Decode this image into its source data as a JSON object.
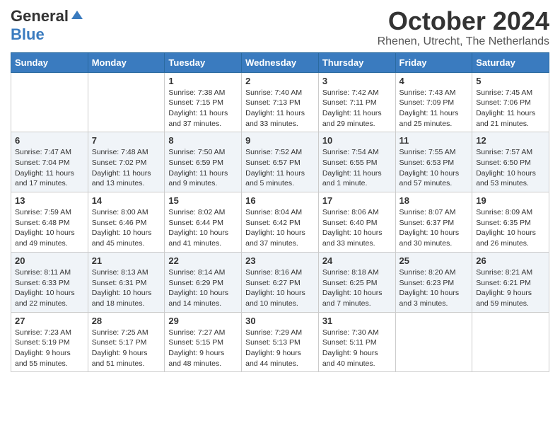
{
  "logo": {
    "general": "General",
    "blue": "Blue"
  },
  "title": "October 2024",
  "location": "Rhenen, Utrecht, The Netherlands",
  "weekdays": [
    "Sunday",
    "Monday",
    "Tuesday",
    "Wednesday",
    "Thursday",
    "Friday",
    "Saturday"
  ],
  "weeks": [
    [
      {
        "day": "",
        "sunrise": "",
        "sunset": "",
        "daylight": ""
      },
      {
        "day": "",
        "sunrise": "",
        "sunset": "",
        "daylight": ""
      },
      {
        "day": "1",
        "sunrise": "Sunrise: 7:38 AM",
        "sunset": "Sunset: 7:15 PM",
        "daylight": "Daylight: 11 hours and 37 minutes."
      },
      {
        "day": "2",
        "sunrise": "Sunrise: 7:40 AM",
        "sunset": "Sunset: 7:13 PM",
        "daylight": "Daylight: 11 hours and 33 minutes."
      },
      {
        "day": "3",
        "sunrise": "Sunrise: 7:42 AM",
        "sunset": "Sunset: 7:11 PM",
        "daylight": "Daylight: 11 hours and 29 minutes."
      },
      {
        "day": "4",
        "sunrise": "Sunrise: 7:43 AM",
        "sunset": "Sunset: 7:09 PM",
        "daylight": "Daylight: 11 hours and 25 minutes."
      },
      {
        "day": "5",
        "sunrise": "Sunrise: 7:45 AM",
        "sunset": "Sunset: 7:06 PM",
        "daylight": "Daylight: 11 hours and 21 minutes."
      }
    ],
    [
      {
        "day": "6",
        "sunrise": "Sunrise: 7:47 AM",
        "sunset": "Sunset: 7:04 PM",
        "daylight": "Daylight: 11 hours and 17 minutes."
      },
      {
        "day": "7",
        "sunrise": "Sunrise: 7:48 AM",
        "sunset": "Sunset: 7:02 PM",
        "daylight": "Daylight: 11 hours and 13 minutes."
      },
      {
        "day": "8",
        "sunrise": "Sunrise: 7:50 AM",
        "sunset": "Sunset: 6:59 PM",
        "daylight": "Daylight: 11 hours and 9 minutes."
      },
      {
        "day": "9",
        "sunrise": "Sunrise: 7:52 AM",
        "sunset": "Sunset: 6:57 PM",
        "daylight": "Daylight: 11 hours and 5 minutes."
      },
      {
        "day": "10",
        "sunrise": "Sunrise: 7:54 AM",
        "sunset": "Sunset: 6:55 PM",
        "daylight": "Daylight: 11 hours and 1 minute."
      },
      {
        "day": "11",
        "sunrise": "Sunrise: 7:55 AM",
        "sunset": "Sunset: 6:53 PM",
        "daylight": "Daylight: 10 hours and 57 minutes."
      },
      {
        "day": "12",
        "sunrise": "Sunrise: 7:57 AM",
        "sunset": "Sunset: 6:50 PM",
        "daylight": "Daylight: 10 hours and 53 minutes."
      }
    ],
    [
      {
        "day": "13",
        "sunrise": "Sunrise: 7:59 AM",
        "sunset": "Sunset: 6:48 PM",
        "daylight": "Daylight: 10 hours and 49 minutes."
      },
      {
        "day": "14",
        "sunrise": "Sunrise: 8:00 AM",
        "sunset": "Sunset: 6:46 PM",
        "daylight": "Daylight: 10 hours and 45 minutes."
      },
      {
        "day": "15",
        "sunrise": "Sunrise: 8:02 AM",
        "sunset": "Sunset: 6:44 PM",
        "daylight": "Daylight: 10 hours and 41 minutes."
      },
      {
        "day": "16",
        "sunrise": "Sunrise: 8:04 AM",
        "sunset": "Sunset: 6:42 PM",
        "daylight": "Daylight: 10 hours and 37 minutes."
      },
      {
        "day": "17",
        "sunrise": "Sunrise: 8:06 AM",
        "sunset": "Sunset: 6:40 PM",
        "daylight": "Daylight: 10 hours and 33 minutes."
      },
      {
        "day": "18",
        "sunrise": "Sunrise: 8:07 AM",
        "sunset": "Sunset: 6:37 PM",
        "daylight": "Daylight: 10 hours and 30 minutes."
      },
      {
        "day": "19",
        "sunrise": "Sunrise: 8:09 AM",
        "sunset": "Sunset: 6:35 PM",
        "daylight": "Daylight: 10 hours and 26 minutes."
      }
    ],
    [
      {
        "day": "20",
        "sunrise": "Sunrise: 8:11 AM",
        "sunset": "Sunset: 6:33 PM",
        "daylight": "Daylight: 10 hours and 22 minutes."
      },
      {
        "day": "21",
        "sunrise": "Sunrise: 8:13 AM",
        "sunset": "Sunset: 6:31 PM",
        "daylight": "Daylight: 10 hours and 18 minutes."
      },
      {
        "day": "22",
        "sunrise": "Sunrise: 8:14 AM",
        "sunset": "Sunset: 6:29 PM",
        "daylight": "Daylight: 10 hours and 14 minutes."
      },
      {
        "day": "23",
        "sunrise": "Sunrise: 8:16 AM",
        "sunset": "Sunset: 6:27 PM",
        "daylight": "Daylight: 10 hours and 10 minutes."
      },
      {
        "day": "24",
        "sunrise": "Sunrise: 8:18 AM",
        "sunset": "Sunset: 6:25 PM",
        "daylight": "Daylight: 10 hours and 7 minutes."
      },
      {
        "day": "25",
        "sunrise": "Sunrise: 8:20 AM",
        "sunset": "Sunset: 6:23 PM",
        "daylight": "Daylight: 10 hours and 3 minutes."
      },
      {
        "day": "26",
        "sunrise": "Sunrise: 8:21 AM",
        "sunset": "Sunset: 6:21 PM",
        "daylight": "Daylight: 9 hours and 59 minutes."
      }
    ],
    [
      {
        "day": "27",
        "sunrise": "Sunrise: 7:23 AM",
        "sunset": "Sunset: 5:19 PM",
        "daylight": "Daylight: 9 hours and 55 minutes."
      },
      {
        "day": "28",
        "sunrise": "Sunrise: 7:25 AM",
        "sunset": "Sunset: 5:17 PM",
        "daylight": "Daylight: 9 hours and 51 minutes."
      },
      {
        "day": "29",
        "sunrise": "Sunrise: 7:27 AM",
        "sunset": "Sunset: 5:15 PM",
        "daylight": "Daylight: 9 hours and 48 minutes."
      },
      {
        "day": "30",
        "sunrise": "Sunrise: 7:29 AM",
        "sunset": "Sunset: 5:13 PM",
        "daylight": "Daylight: 9 hours and 44 minutes."
      },
      {
        "day": "31",
        "sunrise": "Sunrise: 7:30 AM",
        "sunset": "Sunset: 5:11 PM",
        "daylight": "Daylight: 9 hours and 40 minutes."
      },
      {
        "day": "",
        "sunrise": "",
        "sunset": "",
        "daylight": ""
      },
      {
        "day": "",
        "sunrise": "",
        "sunset": "",
        "daylight": ""
      }
    ]
  ]
}
